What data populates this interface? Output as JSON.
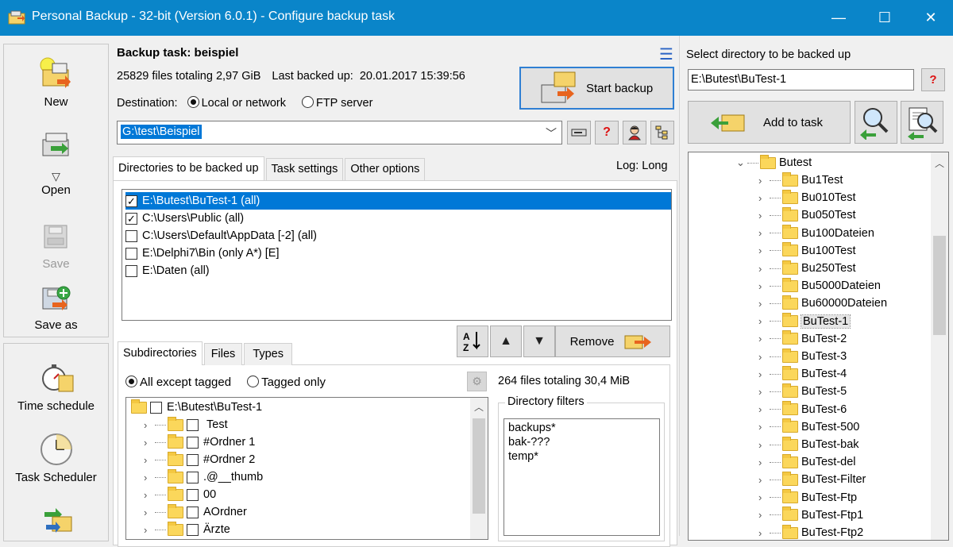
{
  "window": {
    "title": "Personal Backup - 32-bit (Version 6.0.1) - Configure backup task",
    "minimize": "—",
    "maximize": "☐",
    "close": "✕"
  },
  "leftbar": {
    "new_label": "New",
    "open_label": "Open",
    "save_label": "Save",
    "save_as_label": "Save as",
    "time_schedule_label": "Time schedule",
    "task_scheduler_label": "Task Scheduler"
  },
  "task": {
    "title": "Backup task: beispiel",
    "files_info": "25829 files totaling 2,97 GiB",
    "last_backed_label": "Last backed up:",
    "last_backed_value": "20.01.2017 15:39:56",
    "destination_label": "Destination:",
    "dest_local": "Local or network",
    "dest_ftp": "FTP server",
    "destination_value": "G:\\test\\Beispiel",
    "start_button": "Start backup",
    "help_button": "?"
  },
  "tabs": {
    "directories": "Directories to be backed up",
    "task_settings": "Task settings",
    "other_options": "Other options",
    "log_label": "Log: Long"
  },
  "directories": [
    {
      "path": "E:\\Butest\\BuTest-1 (all)",
      "checked": "✓"
    },
    {
      "path": "C:\\Users\\Public (all)",
      "checked": "✓"
    },
    {
      "path": "C:\\Users\\Default\\AppData [-2] (all)",
      "checked": ""
    },
    {
      "path": "E:\\Delphi7\\Bin (only A*) [E]",
      "checked": ""
    },
    {
      "path": "E:\\Daten (all)",
      "checked": ""
    }
  ],
  "toolbar": {
    "sort_label": "AZ",
    "up_icon": "▲",
    "down_icon": "▼",
    "remove_label": "Remove"
  },
  "subtabs": {
    "subdirectories": "Subdirectories",
    "files": "Files",
    "types": "Types"
  },
  "subdir": {
    "all_except": "All except tagged",
    "tagged_only": "Tagged only",
    "file_count": "264 files totaling 30,4 MiB",
    "root": "E:\\Butest\\BuTest-1",
    "items": [
      "Test",
      "#Ordner 1",
      "#Ordner 2",
      ".@__thumb",
      "00",
      "AOrdner",
      "Ärzte"
    ]
  },
  "filters": {
    "legend": "Directory filters",
    "lines": [
      "backups*",
      "bak-???",
      "temp*"
    ]
  },
  "right": {
    "label": "Select directory to be backed up",
    "path_value": "E:\\Butest\\BuTest-1",
    "help_button": "?",
    "add_label": "Add to task",
    "tree_root": "Butest",
    "tree_items": [
      "Bu1Test",
      "Bu010Test",
      "Bu050Test",
      "Bu100Dateien",
      "Bu100Test",
      "Bu250Test",
      "Bu5000Dateien",
      "Bu60000Dateien",
      "BuTest-1",
      "BuTest-2",
      "BuTest-3",
      "BuTest-4",
      "BuTest-5",
      "BuTest-6",
      "BuTest-500",
      "BuTest-bak",
      "BuTest-del",
      "BuTest-Filter",
      "BuTest-Ftp",
      "BuTest-Ftp1",
      "BuTest-Ftp2"
    ],
    "selected_item": "BuTest-1"
  },
  "colors": {
    "titlebar": "#0a85c9",
    "selection": "#0078d7",
    "accent_border": "#2f7fd3"
  }
}
